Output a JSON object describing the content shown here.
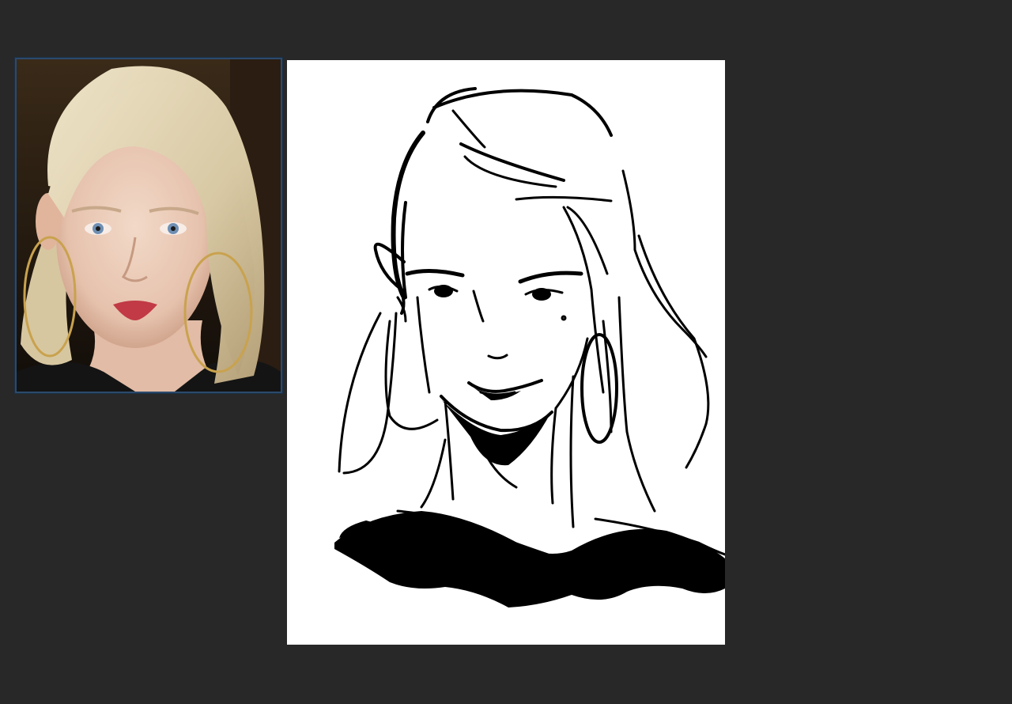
{
  "workspace": {
    "background_color": "#282828"
  },
  "reference_panel": {
    "border_color": "#2c4a6b",
    "content": "reference-photo"
  },
  "canvas": {
    "background_color": "#ffffff",
    "ink_color": "#000000",
    "content": "ink-sketch"
  }
}
